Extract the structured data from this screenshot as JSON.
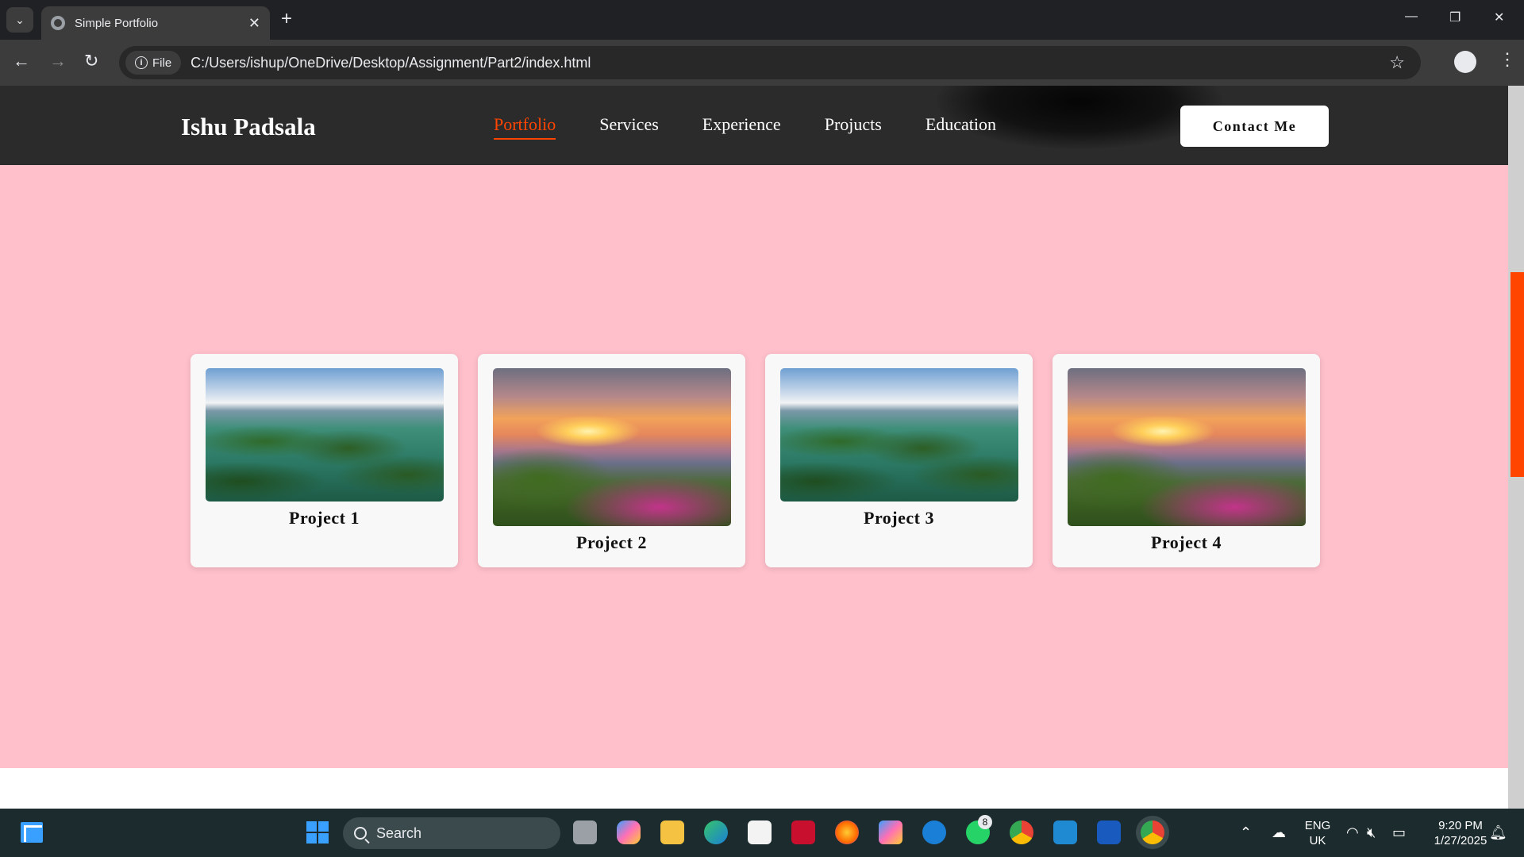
{
  "browser": {
    "tab_title": "Simple Portfolio",
    "tab_close": "✕",
    "new_tab": "+",
    "scheme_chip": "File",
    "url": "C:/Users/ishup/OneDrive/Desktop/Assignment/Part2/index.html",
    "window_controls": {
      "minimize": "—",
      "restore": "❐",
      "close": "✕"
    },
    "nav": {
      "back": "←",
      "forward": "→",
      "reload": "↻",
      "star": "☆",
      "menu": "⋮"
    }
  },
  "site": {
    "brand": "Ishu Padsala",
    "nav": [
      "Portfolio",
      "Services",
      "Experience",
      "Projucts",
      "Education"
    ],
    "active_nav": "Portfolio",
    "contact_button": "Contact Me",
    "projects": [
      {
        "title": "Project 1",
        "image": "lake-islands"
      },
      {
        "title": "Project 2",
        "image": "mountain-sunset"
      },
      {
        "title": "Project 3",
        "image": "lake-islands"
      },
      {
        "title": "Project 4",
        "image": "mountain-sunset"
      }
    ],
    "colors": {
      "header_bg": "#2b2b2b",
      "accent": "#ff4500",
      "section_bg": "#ffc0cb"
    }
  },
  "taskbar": {
    "search_label": "Search",
    "whatsapp_badge": "8",
    "lang_line1": "ENG",
    "lang_line2": "UK",
    "time": "9:20 PM",
    "date": "1/27/2025",
    "apps": [
      "start-icon",
      "windows-icon",
      "task-view-icon",
      "copilot-icon",
      "file-explorer-icon",
      "edge-icon",
      "store-icon",
      "mcafee-icon",
      "firefox-icon",
      "m365-icon",
      "dell-icon",
      "whatsapp-icon",
      "chrome-icon",
      "vscode-icon",
      "word-icon",
      "chrome-icon"
    ]
  }
}
